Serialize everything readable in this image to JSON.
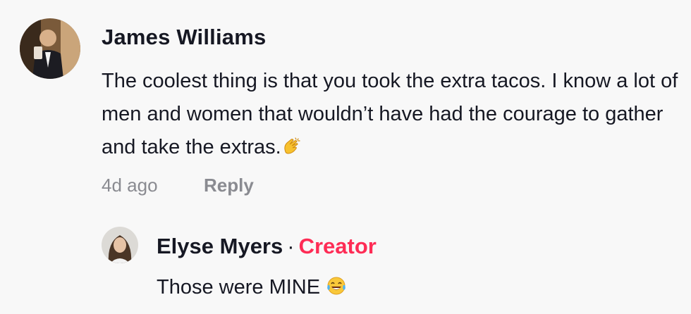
{
  "comment": {
    "author": "James Williams",
    "text": "The coolest thing is that you took the extra tacos. I know a lot of men and women that wouldn’t have had the courage to gather and take the extras.",
    "emoji": "clapping-hands-emoji",
    "timestamp": "4d ago",
    "reply_label": "Reply"
  },
  "reply": {
    "author": "Elyse Myers",
    "separator": "·",
    "badge": "Creator",
    "text": "Those were MINE",
    "emoji": "tears-of-joy-emoji"
  },
  "colors": {
    "background": "#f8f8f8",
    "text": "#161823",
    "muted": "#8a8b91",
    "creator_badge": "#fe2c55"
  }
}
